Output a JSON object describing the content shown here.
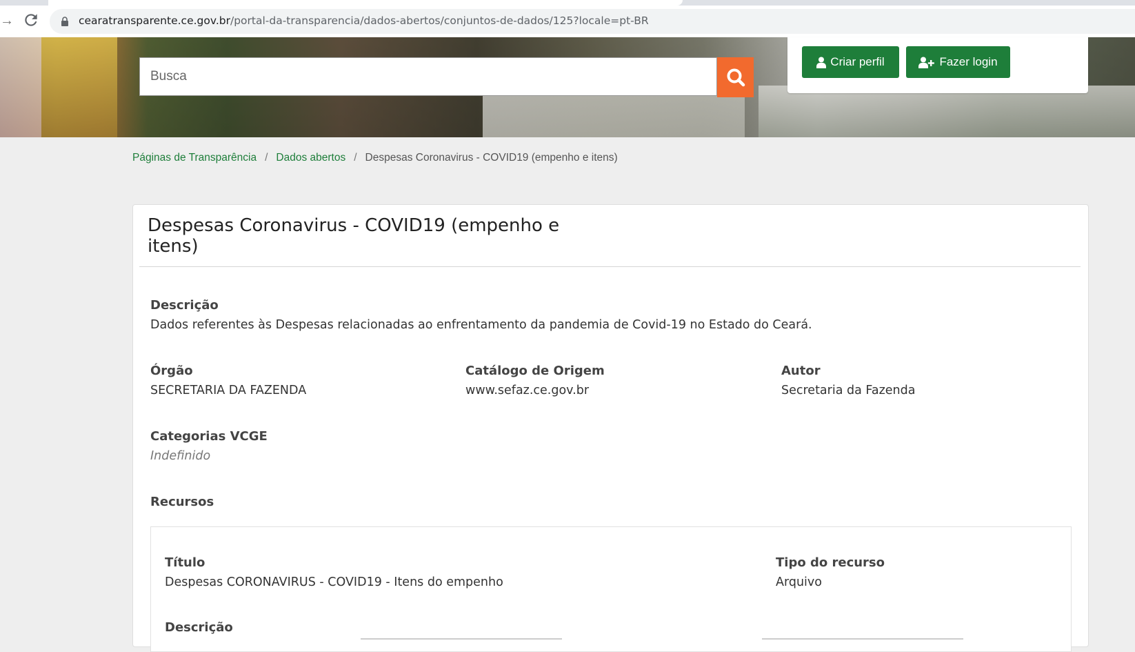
{
  "browser": {
    "url_host": "cearatransparente.ce.gov.br",
    "url_path": "/portal-da-transparencia/dados-abertos/conjuntos-de-dados/125?locale=pt-BR"
  },
  "header": {
    "search_placeholder": "Busca",
    "criar_perfil": "Criar perfil",
    "fazer_login": "Fazer login"
  },
  "breadcrumb": {
    "items": [
      "Páginas de Transparência",
      "Dados abertos"
    ],
    "separator": "/",
    "current": "Despesas Coronavirus - COVID19 (empenho e itens)"
  },
  "dataset": {
    "title": "Despesas Coronavirus - COVID19 (empenho e itens)",
    "descricao_label": "Descrição",
    "descricao_value": "Dados referentes às Despesas relacionadas ao enfrentamento da pandemia de Covid-19 no Estado do Ceará.",
    "orgao_label": "Órgão",
    "orgao_value": "SECRETARIA DA FAZENDA",
    "catalogo_label": "Catálogo de Origem",
    "catalogo_value": "www.sefaz.ce.gov.br",
    "autor_label": "Autor",
    "autor_value": "Secretaria da Fazenda",
    "categorias_label": "Categorias VCGE",
    "categorias_value": "Indefinido",
    "recursos_label": "Recursos"
  },
  "resource": {
    "titulo_label": "Título",
    "titulo_value": "Despesas CORONAVIRUS - COVID19 - Itens do empenho",
    "tipo_label": "Tipo do recurso",
    "tipo_value": "Arquivo",
    "descricao_label": "Descrição"
  },
  "colors": {
    "green": "#1e7e3a",
    "orange": "#f26a2e"
  }
}
